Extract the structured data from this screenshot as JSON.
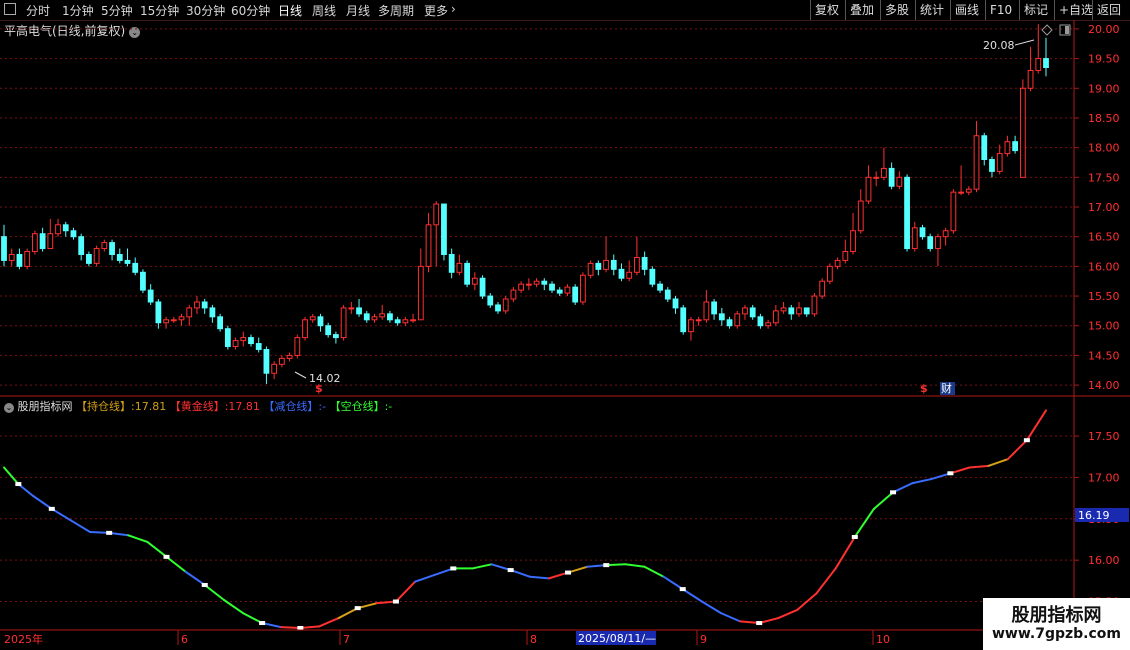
{
  "toolbar": {
    "icon": "window-restore-icon",
    "periods": [
      "分时",
      "1分钟",
      "5分钟",
      "15分钟",
      "30分钟",
      "60分钟",
      "日线",
      "周线",
      "月线",
      "多周期",
      "更多"
    ],
    "active_period": "日线",
    "more_arrow": "›",
    "right_buttons": [
      "复权",
      "叠加",
      "多股",
      "统计",
      "画线",
      "F10",
      "标记",
      "+自选",
      "返回"
    ]
  },
  "chart": {
    "title": "平高电气(日线,前复权)",
    "high_label": "20.08",
    "low_label": "14.02",
    "price_axis": [
      "20.00",
      "19.50",
      "19.00",
      "18.50",
      "18.00",
      "17.50",
      "17.00",
      "16.50",
      "16.00",
      "15.50",
      "15.00",
      "14.50",
      "14.00"
    ],
    "markers": [
      {
        "text": "$",
        "color": "#ff3030"
      },
      {
        "text": "$",
        "color": "#ff3030"
      },
      {
        "text": "财",
        "color": "#ffffff"
      }
    ],
    "top_right_icons": [
      "diamond-icon",
      "panel-icon"
    ]
  },
  "indicator": {
    "name": "股朋指标网",
    "lines": [
      {
        "label": "【持仓线】",
        "value": ":17.81",
        "color": "#d4a017"
      },
      {
        "label": "【黄金线】",
        "value": ":17.81",
        "color": "#ff3030"
      },
      {
        "label": "【减仓线】",
        "value": ":-",
        "color": "#3a6cff"
      },
      {
        "label": "【空仓线】",
        "value": ":-",
        "color": "#30ff30"
      }
    ],
    "axis": [
      "17.50",
      "17.00",
      "16.50",
      "16.00",
      "15.50"
    ],
    "current_value": "16.19"
  },
  "date_axis": {
    "labels": [
      "2025年",
      "6",
      "7",
      "8",
      "9",
      "10"
    ],
    "cursor": "2025/08/11/—"
  },
  "watermark": {
    "title": "股朋指标网",
    "url": "www.7gpzb.com"
  },
  "colors": {
    "up": "#ff3030",
    "down": "#54ffff",
    "grid": "#7a1010",
    "axis": "#b01818",
    "text": "#d8d8d8"
  },
  "chart_data": {
    "type": "candlestick",
    "y_range": [
      13.85,
      20.15
    ],
    "candles": [
      [
        16.5,
        16.1,
        16.7,
        16.0
      ],
      [
        16.1,
        16.2,
        16.3,
        16.0
      ],
      [
        16.2,
        16.0,
        16.3,
        15.95
      ],
      [
        16.0,
        16.25,
        16.3,
        15.95
      ],
      [
        16.25,
        16.55,
        16.6,
        16.2
      ],
      [
        16.55,
        16.3,
        16.65,
        16.25
      ],
      [
        16.3,
        16.55,
        16.8,
        16.3
      ],
      [
        16.55,
        16.7,
        16.8,
        16.5
      ],
      [
        16.7,
        16.6,
        16.75,
        16.5
      ],
      [
        16.6,
        16.5,
        16.65,
        16.45
      ],
      [
        16.5,
        16.2,
        16.55,
        16.1
      ],
      [
        16.2,
        16.05,
        16.25,
        16.0
      ],
      [
        16.05,
        16.3,
        16.35,
        16.0
      ],
      [
        16.3,
        16.4,
        16.45,
        16.25
      ],
      [
        16.4,
        16.2,
        16.45,
        16.1
      ],
      [
        16.2,
        16.1,
        16.3,
        16.05
      ],
      [
        16.1,
        16.05,
        16.3,
        16.0
      ],
      [
        16.05,
        15.9,
        16.15,
        15.85
      ],
      [
        15.9,
        15.6,
        15.95,
        15.55
      ],
      [
        15.6,
        15.4,
        15.7,
        15.35
      ],
      [
        15.4,
        15.05,
        15.45,
        14.95
      ],
      [
        15.05,
        15.1,
        15.15,
        14.95
      ],
      [
        15.1,
        15.1,
        15.15,
        15.05
      ],
      [
        15.1,
        15.15,
        15.2,
        15.0
      ],
      [
        15.15,
        15.3,
        15.35,
        15.0
      ],
      [
        15.3,
        15.4,
        15.5,
        15.2
      ],
      [
        15.4,
        15.3,
        15.45,
        15.2
      ],
      [
        15.3,
        15.15,
        15.35,
        15.05
      ],
      [
        15.15,
        14.95,
        15.2,
        14.9
      ],
      [
        14.95,
        14.65,
        15.0,
        14.6
      ],
      [
        14.65,
        14.75,
        14.8,
        14.6
      ],
      [
        14.75,
        14.8,
        14.9,
        14.65
      ],
      [
        14.8,
        14.7,
        14.85,
        14.65
      ],
      [
        14.7,
        14.6,
        14.8,
        14.55
      ],
      [
        14.6,
        14.2,
        14.65,
        14.02
      ],
      [
        14.2,
        14.35,
        14.4,
        14.1
      ],
      [
        14.35,
        14.45,
        14.5,
        14.3
      ],
      [
        14.45,
        14.5,
        14.55,
        14.4
      ],
      [
        14.5,
        14.8,
        14.85,
        14.45
      ],
      [
        14.8,
        15.1,
        15.15,
        14.75
      ],
      [
        15.1,
        15.15,
        15.2,
        15.05
      ],
      [
        15.15,
        15.0,
        15.2,
        14.9
      ],
      [
        15.0,
        14.85,
        15.05,
        14.8
      ],
      [
        14.85,
        14.8,
        14.9,
        14.7
      ],
      [
        14.8,
        15.3,
        15.35,
        14.75
      ],
      [
        15.3,
        15.3,
        15.4,
        15.2
      ],
      [
        15.3,
        15.2,
        15.45,
        15.15
      ],
      [
        15.2,
        15.1,
        15.25,
        15.05
      ],
      [
        15.1,
        15.15,
        15.2,
        15.05
      ],
      [
        15.15,
        15.2,
        15.35,
        15.1
      ],
      [
        15.2,
        15.1,
        15.25,
        15.05
      ],
      [
        15.1,
        15.05,
        15.15,
        15.0
      ],
      [
        15.05,
        15.1,
        15.15,
        15.0
      ],
      [
        15.1,
        15.1,
        15.2,
        15.05
      ],
      [
        15.1,
        16.0,
        16.3,
        15.95
      ],
      [
        16.0,
        16.7,
        16.9,
        15.9
      ],
      [
        16.7,
        17.05,
        17.1,
        16.0
      ],
      [
        17.05,
        16.2,
        17.05,
        16.1
      ],
      [
        16.2,
        15.9,
        16.3,
        15.8
      ],
      [
        15.9,
        16.05,
        16.2,
        15.85
      ],
      [
        16.05,
        15.7,
        16.1,
        15.65
      ],
      [
        15.7,
        15.8,
        15.9,
        15.6
      ],
      [
        15.8,
        15.5,
        15.85,
        15.45
      ],
      [
        15.5,
        15.35,
        15.55,
        15.3
      ],
      [
        15.35,
        15.25,
        15.4,
        15.2
      ],
      [
        15.25,
        15.45,
        15.5,
        15.2
      ],
      [
        15.45,
        15.6,
        15.65,
        15.4
      ],
      [
        15.6,
        15.7,
        15.75,
        15.55
      ],
      [
        15.7,
        15.7,
        15.8,
        15.6
      ],
      [
        15.7,
        15.75,
        15.8,
        15.65
      ],
      [
        15.75,
        15.7,
        15.8,
        15.6
      ],
      [
        15.7,
        15.6,
        15.75,
        15.55
      ],
      [
        15.6,
        15.55,
        15.65,
        15.5
      ],
      [
        15.55,
        15.65,
        15.7,
        15.5
      ],
      [
        15.65,
        15.4,
        15.7,
        15.35
      ],
      [
        15.4,
        15.85,
        15.9,
        15.35
      ],
      [
        15.85,
        16.05,
        16.1,
        15.8
      ],
      [
        16.05,
        15.95,
        16.1,
        15.85
      ],
      [
        15.95,
        16.1,
        16.5,
        15.9
      ],
      [
        16.1,
        15.95,
        16.2,
        15.85
      ],
      [
        15.95,
        15.8,
        16.05,
        15.75
      ],
      [
        15.8,
        15.9,
        16.1,
        15.75
      ],
      [
        15.9,
        16.15,
        16.5,
        15.85
      ],
      [
        16.15,
        15.95,
        16.25,
        15.85
      ],
      [
        15.95,
        15.7,
        16.0,
        15.65
      ],
      [
        15.7,
        15.6,
        15.75,
        15.55
      ],
      [
        15.6,
        15.45,
        15.65,
        15.4
      ],
      [
        15.45,
        15.3,
        15.5,
        15.2
      ],
      [
        15.3,
        14.9,
        15.35,
        14.85
      ],
      [
        14.9,
        15.1,
        15.15,
        14.75
      ],
      [
        15.1,
        15.1,
        15.15,
        15.0
      ],
      [
        15.1,
        15.4,
        15.6,
        15.05
      ],
      [
        15.4,
        15.2,
        15.45,
        15.1
      ],
      [
        15.2,
        15.1,
        15.3,
        15.0
      ],
      [
        15.1,
        15.0,
        15.15,
        14.95
      ],
      [
        15.0,
        15.2,
        15.25,
        14.95
      ],
      [
        15.2,
        15.3,
        15.35,
        15.1
      ],
      [
        15.3,
        15.15,
        15.35,
        15.1
      ],
      [
        15.15,
        15.0,
        15.2,
        14.95
      ],
      [
        15.0,
        15.05,
        15.1,
        14.95
      ],
      [
        15.05,
        15.25,
        15.35,
        15.0
      ],
      [
        15.25,
        15.3,
        15.4,
        15.2
      ],
      [
        15.3,
        15.2,
        15.35,
        15.1
      ],
      [
        15.2,
        15.3,
        15.4,
        15.15
      ],
      [
        15.3,
        15.2,
        15.3,
        15.15
      ],
      [
        15.2,
        15.5,
        15.55,
        15.15
      ],
      [
        15.5,
        15.75,
        15.8,
        15.45
      ],
      [
        15.75,
        16.0,
        16.05,
        15.7
      ],
      [
        16.0,
        16.1,
        16.15,
        15.95
      ],
      [
        16.1,
        16.25,
        16.45,
        16.05
      ],
      [
        16.25,
        16.6,
        16.9,
        16.2
      ],
      [
        16.6,
        17.1,
        17.3,
        16.55
      ],
      [
        17.1,
        17.5,
        17.7,
        17.05
      ],
      [
        17.5,
        17.5,
        17.6,
        17.35
      ],
      [
        17.5,
        17.65,
        18.0,
        17.45
      ],
      [
        17.65,
        17.35,
        17.75,
        17.3
      ],
      [
        17.35,
        17.5,
        17.6,
        17.3
      ],
      [
        17.5,
        16.3,
        17.55,
        16.25
      ],
      [
        16.3,
        16.65,
        16.75,
        16.25
      ],
      [
        16.65,
        16.5,
        16.7,
        16.45
      ],
      [
        16.5,
        16.3,
        16.55,
        16.25
      ],
      [
        16.3,
        16.5,
        16.55,
        16.0
      ],
      [
        16.5,
        16.6,
        16.65,
        16.35
      ],
      [
        16.6,
        17.25,
        17.3,
        16.55
      ],
      [
        17.25,
        17.25,
        17.7,
        17.2
      ],
      [
        17.25,
        17.3,
        17.35,
        17.2
      ],
      [
        17.3,
        18.2,
        18.45,
        17.25
      ],
      [
        18.2,
        17.8,
        18.25,
        17.7
      ],
      [
        17.8,
        17.6,
        17.85,
        17.5
      ],
      [
        17.6,
        17.9,
        18.05,
        17.55
      ],
      [
        17.9,
        18.1,
        18.2,
        17.85
      ],
      [
        18.1,
        17.95,
        18.2,
        17.9
      ],
      [
        17.5,
        19.0,
        19.15,
        17.5
      ],
      [
        19.0,
        19.3,
        19.7,
        18.95
      ],
      [
        19.3,
        19.5,
        20.08,
        19.25
      ],
      [
        19.5,
        19.35,
        19.85,
        19.2
      ]
    ],
    "indicator_range": [
      15.18,
      17.96
    ],
    "indicator_series": [
      [
        0,
        17.12,
        "#30ff30"
      ],
      [
        3,
        16.92,
        "#30ff30"
      ],
      [
        6,
        16.78,
        "#3a6cff"
      ],
      [
        10,
        16.62,
        "#3a6cff"
      ],
      [
        14,
        16.48,
        "#3a6cff"
      ],
      [
        18,
        16.34,
        "#3a6cff"
      ],
      [
        22,
        16.33,
        "#3a6cff"
      ],
      [
        26,
        16.3,
        "#3a6cff"
      ],
      [
        30,
        16.22,
        "#30ff30"
      ],
      [
        34,
        16.04,
        "#30ff30"
      ],
      [
        38,
        15.86,
        "#30ff30"
      ],
      [
        42,
        15.7,
        "#3a6cff"
      ],
      [
        46,
        15.52,
        "#30ff30"
      ],
      [
        50,
        15.36,
        "#30ff30"
      ],
      [
        54,
        15.24,
        "#30ff30"
      ],
      [
        58,
        15.19,
        "#3a6cff"
      ],
      [
        62,
        15.18,
        "#ff3030"
      ],
      [
        66,
        15.2,
        "#ff3030"
      ],
      [
        70,
        15.3,
        "#ff3030"
      ],
      [
        74,
        15.42,
        "#d4a017"
      ],
      [
        78,
        15.48,
        "#d4a017"
      ],
      [
        82,
        15.5,
        "#ff3030"
      ],
      [
        86,
        15.74,
        "#ff3030"
      ],
      [
        90,
        15.82,
        "#3a6cff"
      ],
      [
        94,
        15.9,
        "#3a6cff"
      ],
      [
        98,
        15.9,
        "#30ff30"
      ],
      [
        102,
        15.95,
        "#30ff30"
      ],
      [
        106,
        15.88,
        "#3a6cff"
      ],
      [
        110,
        15.8,
        "#3a6cff"
      ],
      [
        114,
        15.78,
        "#3a6cff"
      ],
      [
        118,
        15.85,
        "#ff3030"
      ],
      [
        122,
        15.92,
        "#d4a017"
      ],
      [
        126,
        15.94,
        "#3a6cff"
      ],
      [
        130,
        15.95,
        "#30ff30"
      ],
      [
        134,
        15.92,
        "#30ff30"
      ],
      [
        138,
        15.8,
        "#30ff30"
      ],
      [
        142,
        15.65,
        "#3a6cff"
      ],
      [
        146,
        15.5,
        "#3a6cff"
      ],
      [
        150,
        15.36,
        "#3a6cff"
      ],
      [
        154,
        15.26,
        "#3a6cff"
      ],
      [
        158,
        15.24,
        "#ff3030"
      ],
      [
        162,
        15.3,
        "#ff3030"
      ],
      [
        166,
        15.4,
        "#ff3030"
      ],
      [
        170,
        15.6,
        "#ff3030"
      ],
      [
        174,
        15.9,
        "#ff3030"
      ],
      [
        178,
        16.28,
        "#ff3030"
      ],
      [
        182,
        16.62,
        "#30ff30"
      ],
      [
        186,
        16.82,
        "#30ff30"
      ],
      [
        190,
        16.93,
        "#3a6cff"
      ],
      [
        194,
        16.98,
        "#3a6cff"
      ],
      [
        198,
        17.05,
        "#3a6cff"
      ],
      [
        202,
        17.12,
        "#ff3030"
      ],
      [
        206,
        17.14,
        "#ff3030"
      ],
      [
        210,
        17.22,
        "#d4a017"
      ],
      [
        214,
        17.45,
        "#ff3030"
      ],
      [
        218,
        17.81,
        "#ff3030"
      ]
    ],
    "indicator_markers": [
      3,
      10,
      22,
      34,
      42,
      54,
      62,
      74,
      82,
      94,
      106,
      118,
      126,
      142,
      158,
      178,
      186,
      198,
      214
    ]
  }
}
